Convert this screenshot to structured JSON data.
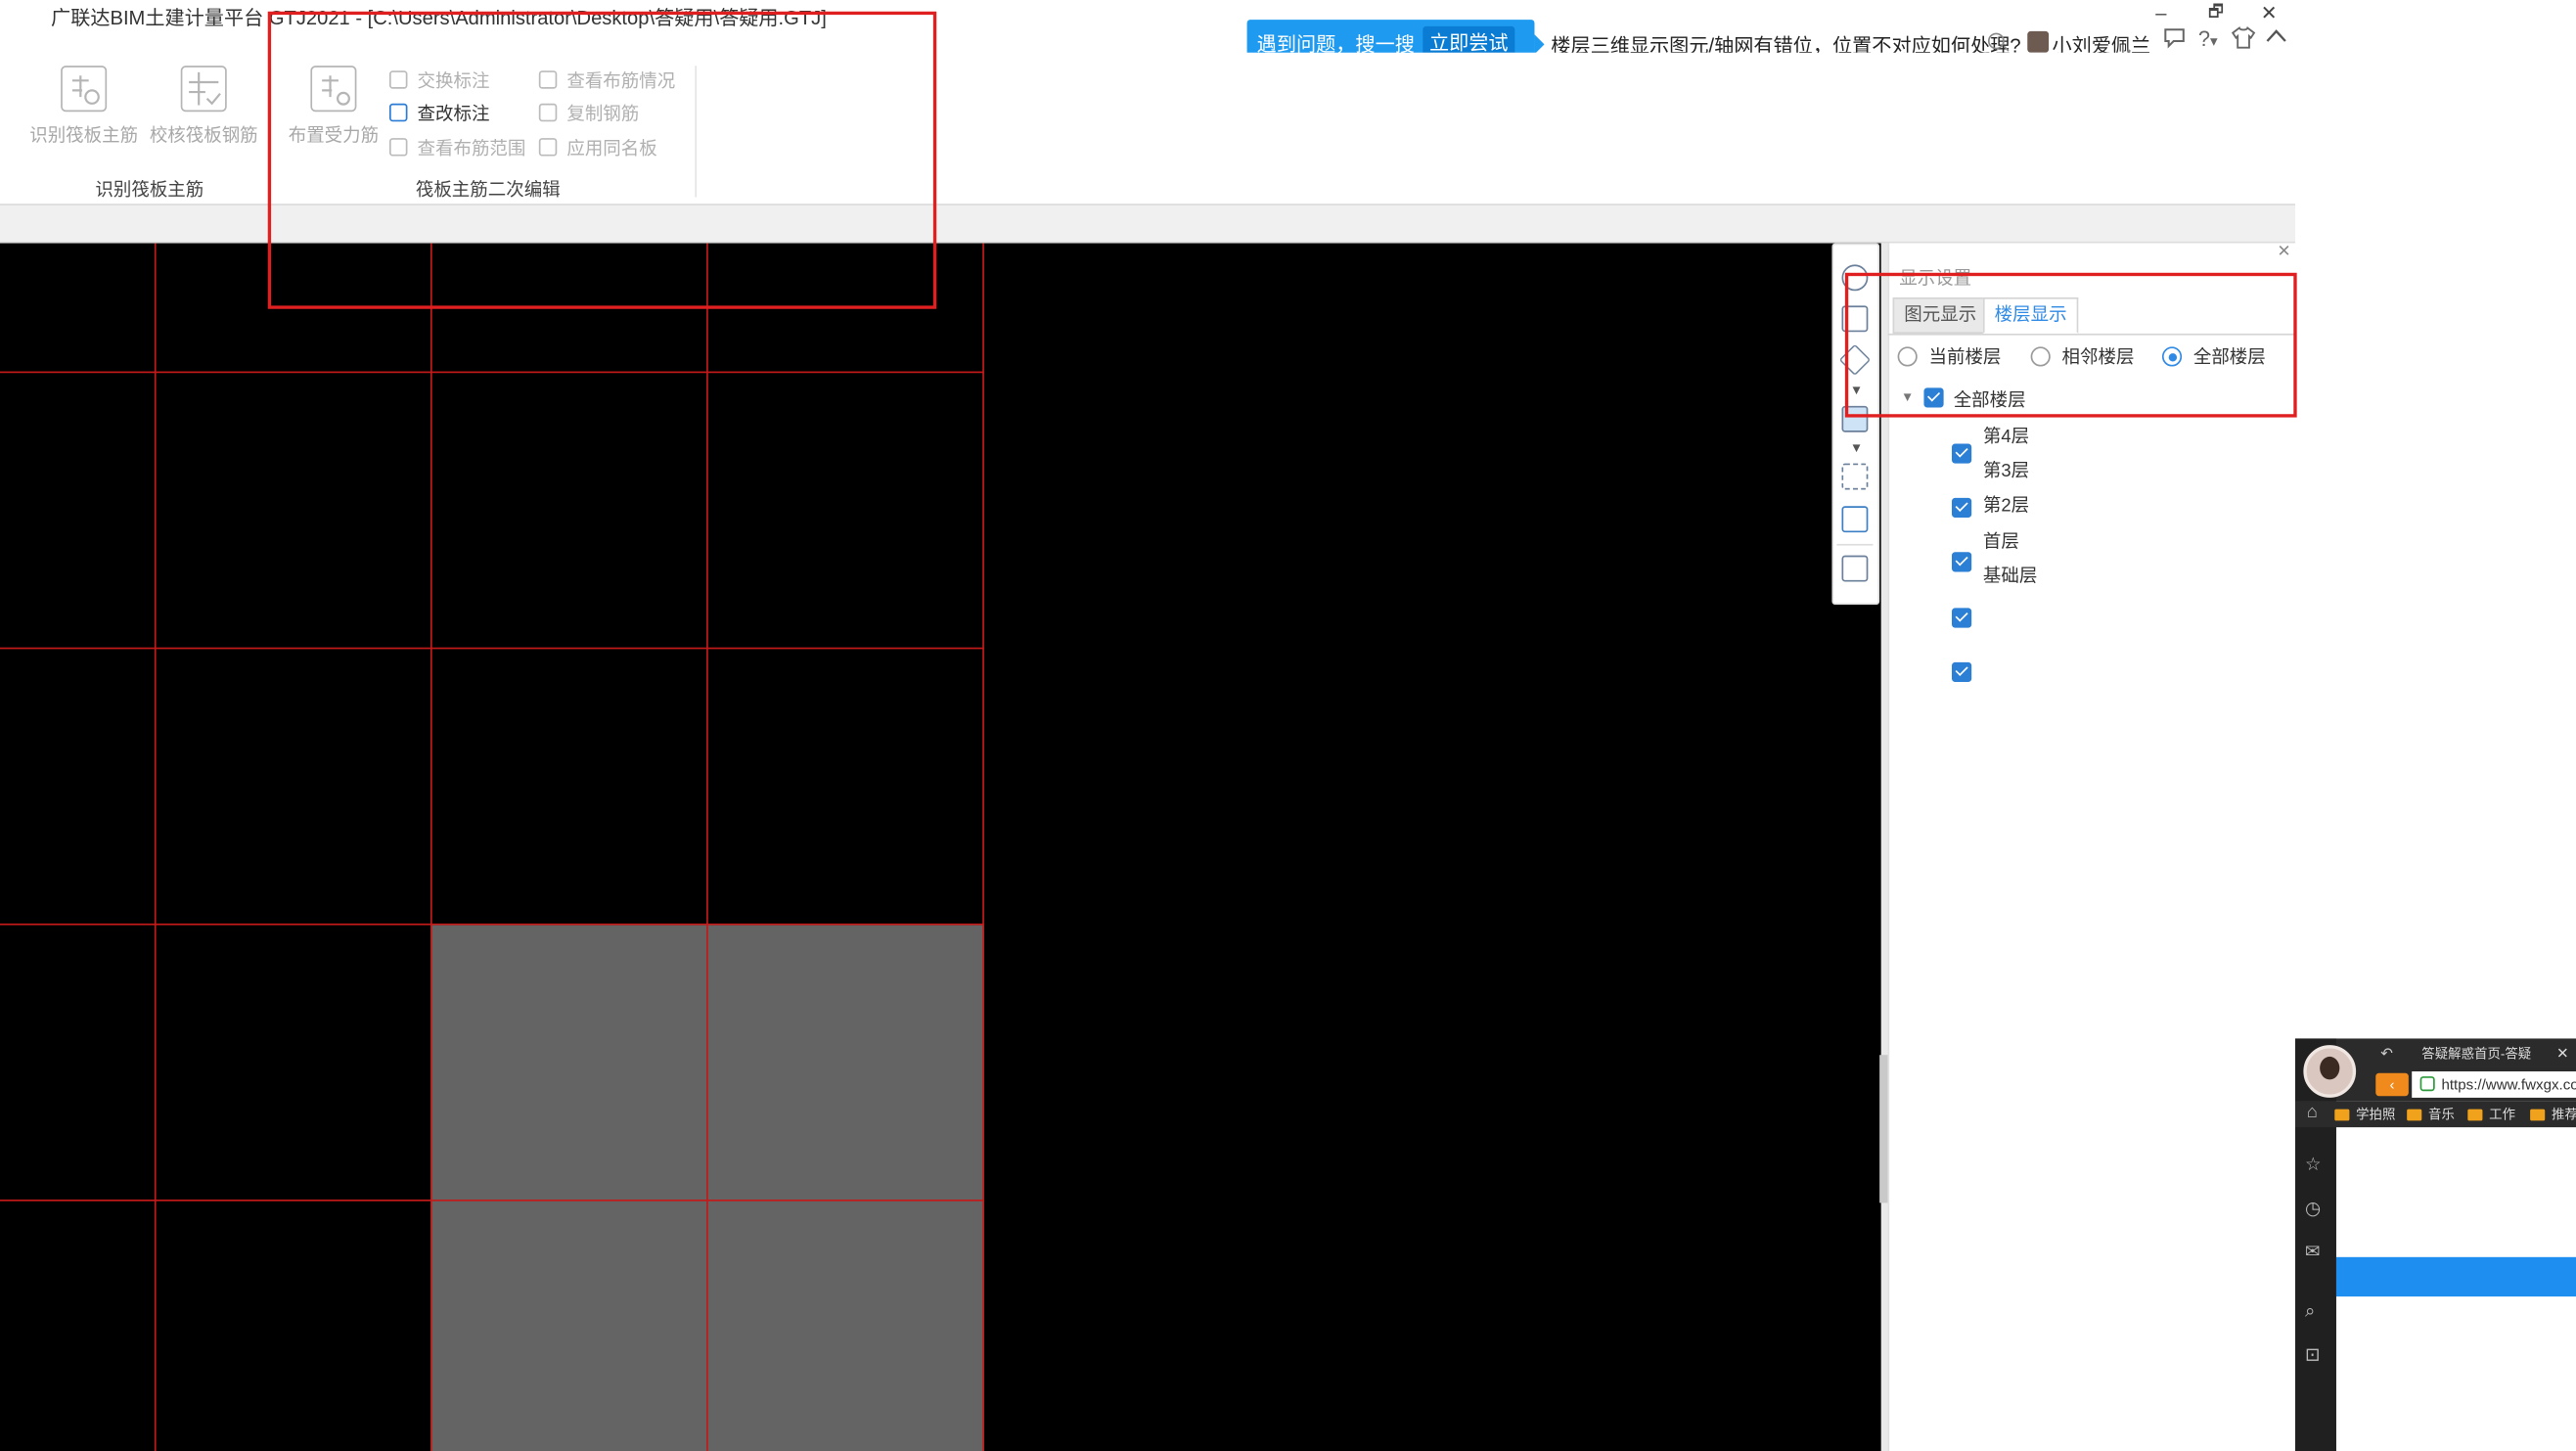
{
  "window": {
    "title": "广联达BIM土建计量平台 GTJ2021 - [C:\\Users\\Administrator\\Desktop\\答疑用\\答疑用.GTJ]",
    "minimize": "–",
    "restore": "🗗",
    "close": "✕"
  },
  "header": {
    "promo_text": "遇到问题，搜一搜",
    "promo_button": "立即尝试",
    "search_query": "楼层三维显示图元/轴网有错位，位置不对应如何处理?",
    "user_name": "小刘爱佩兰",
    "icons": [
      "chat-icon",
      "help-icon",
      "skin-icon",
      "collapse-ribbon-icon"
    ]
  },
  "ribbon": {
    "group1": {
      "label": "识别筏板主筋",
      "buttons": [
        {
          "label": "识别筏板主筋",
          "icon": "identify-raft-rebar-icon"
        },
        {
          "label": "校核筏板钢筋",
          "icon": "check-raft-rebar-icon"
        }
      ]
    },
    "group2": {
      "label": "筏板主筋二次编辑",
      "big_button": {
        "label": "布置受力筋",
        "icon": "place-rebar-icon"
      },
      "col1": [
        "交换标注",
        "查改标注",
        "查看布筋范围"
      ],
      "col2": [
        "查看布筋情况",
        "复制钢筋",
        "应用同名板"
      ]
    }
  },
  "canvas": {
    "background": "#000000",
    "grid_color": "#c41a1a",
    "fill_color": "#646464"
  },
  "panel": {
    "title": "显示设置",
    "tabs": [
      "图元显示",
      "楼层显示"
    ],
    "active_tab": "楼层显示",
    "radios": [
      "当前楼层",
      "相邻楼层",
      "全部楼层"
    ],
    "selected_radio": "全部楼层",
    "tree_root": "全部楼层",
    "floors": [
      "第4层",
      "第3层",
      "第2层",
      "首层",
      "基础层"
    ]
  },
  "browser": {
    "tab_title": "答疑解惑首页-答疑",
    "url": "https://www.fwxgx.com",
    "bookmarks": [
      "学拍照",
      "音乐",
      "工作",
      "推荐"
    ]
  }
}
